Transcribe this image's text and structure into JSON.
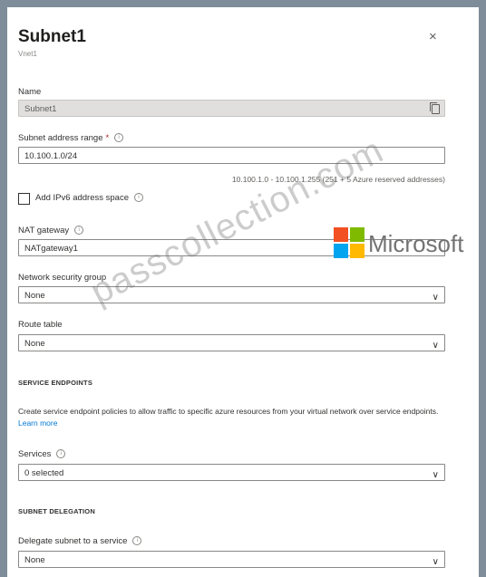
{
  "header": {
    "title": "Subnet1",
    "subtitle": "Vnet1",
    "close_symbol": "×"
  },
  "name": {
    "label": "Name",
    "value": "Subnet1"
  },
  "address_range": {
    "label": "Subnet address range",
    "required_mark": "*",
    "value": "10.100.1.0/24",
    "hint": "10.100.1.0 - 10.100.1.255 (251 + 5 Azure reserved addresses)"
  },
  "ipv6": {
    "label": "Add IPv6 address space",
    "checked": false
  },
  "nat_gateway": {
    "label": "NAT gateway",
    "value": "NATgateway1"
  },
  "nsg": {
    "label": "Network security group",
    "value": "None"
  },
  "route_table": {
    "label": "Route table",
    "value": "None"
  },
  "service_endpoints": {
    "heading": "SERVICE ENDPOINTS",
    "description": "Create service endpoint policies to allow traffic to specific azure resources from your virtual network over service endpoints.",
    "link_text": "Learn more",
    "services_label": "Services",
    "services_value": "0 selected"
  },
  "delegation": {
    "heading": "SUBNET DELEGATION",
    "label": "Delegate subnet to a service",
    "value": "None"
  },
  "overlay": {
    "brand": "Microsoft",
    "watermark": "passcollection.com",
    "logo_colors": [
      "#f25022",
      "#7fba00",
      "#00a4ef",
      "#ffb900"
    ]
  },
  "icons": {
    "info": "info-icon",
    "copy": "copy-icon",
    "dropdown": "chevron-down-icon",
    "info_glyph": "i",
    "chevron_glyph": "∨"
  }
}
